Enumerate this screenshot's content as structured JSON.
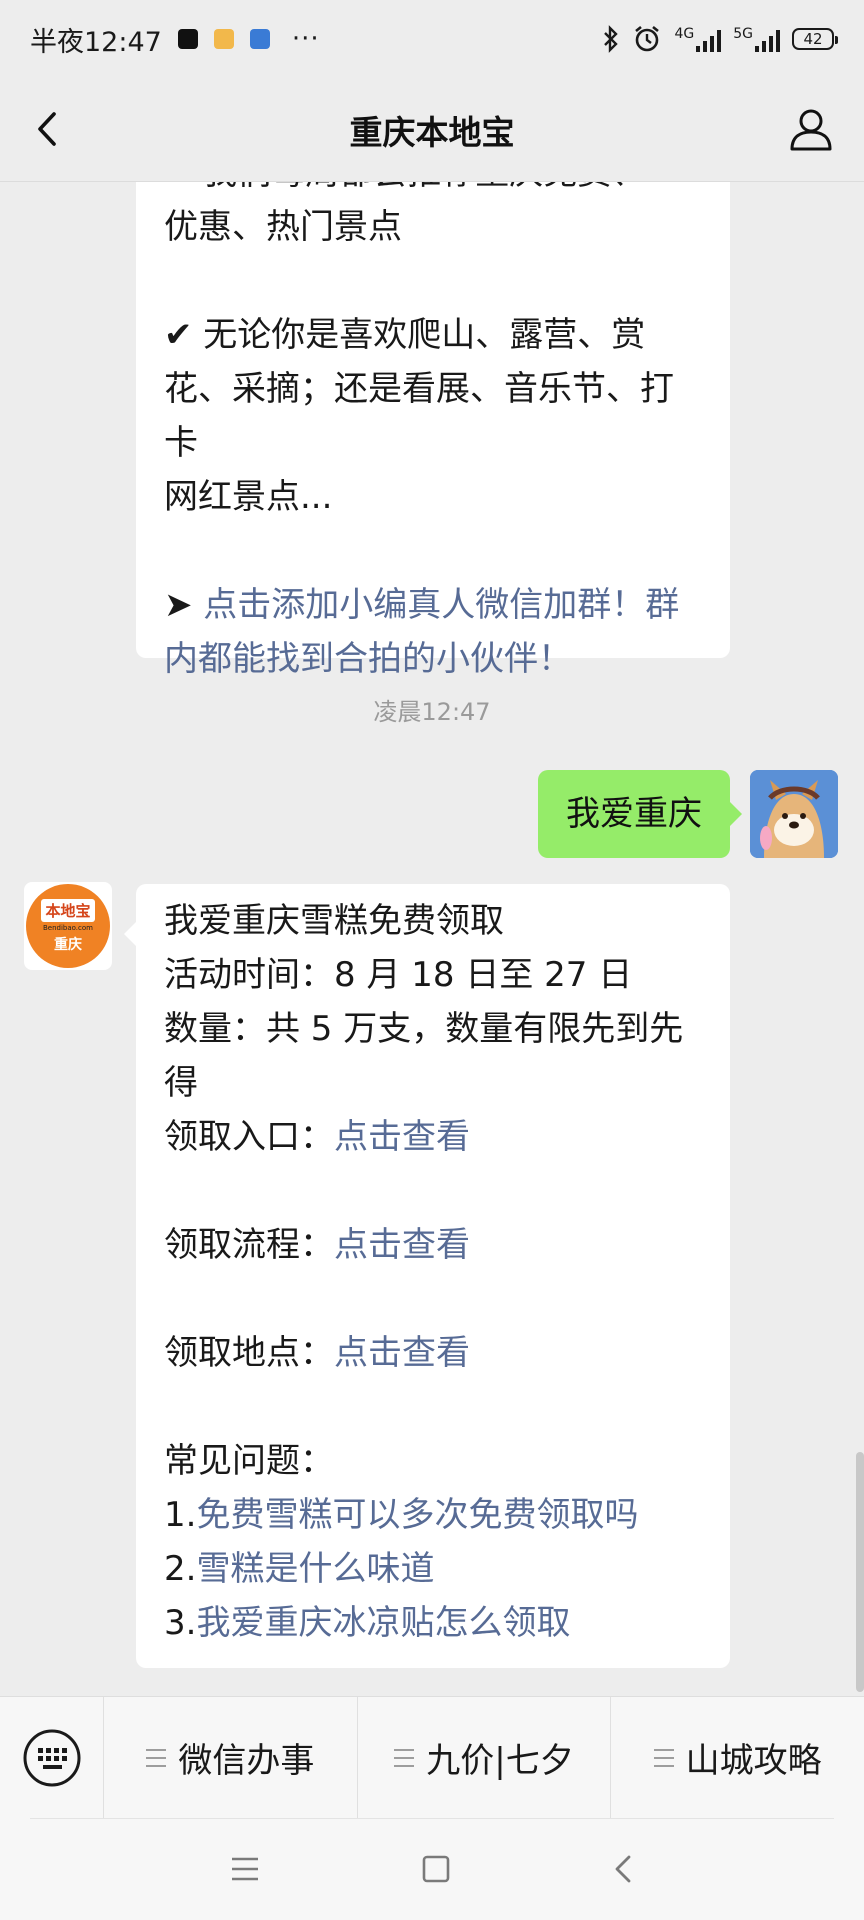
{
  "status_bar": {
    "time": "半夜12:47",
    "dots": "···",
    "net1": "4G",
    "net2": "5G",
    "battery": "42"
  },
  "header": {
    "title": "重庆本地宝"
  },
  "chat": {
    "top_bubble": {
      "line1": "✔ 我们每周都会推荐重庆免费、",
      "line2": "优惠、热门景点",
      "line3": "✔ 无论你是喜欢爬山、露营、赏",
      "line4": "花、采摘；还是看展、音乐节、打卡",
      "line5": "网红景点...",
      "line6_prefix": "➤ ",
      "line6_link": "点击添加小编真人微信加群！群",
      "line7_link": "内都能找到合拍的小伙伴！"
    },
    "timestamp": "凌晨12:47",
    "my_message": "我爱重庆",
    "bot_avatar": {
      "label_top": "本地宝",
      "site": "Bendibao.com",
      "label_bottom": "重庆"
    },
    "bot_reply": {
      "title": "我爱重庆雪糕免费领取",
      "time": "活动时间：8 月 18 日至 27 日",
      "qty1": "数量：共 5 万支，数量有限先到先",
      "qty2": "得",
      "entry_label": "领取入口：",
      "entry_link": "点击查看",
      "flow_label": "领取流程：",
      "flow_link": "点击查看",
      "place_label": "领取地点：",
      "place_link": "点击查看",
      "faq_title": "常见问题：",
      "faq": [
        {
          "num": "1.",
          "text": "免费雪糕可以多次免费领取吗"
        },
        {
          "num": "2.",
          "text": "雪糕是什么味道"
        },
        {
          "num": "3.",
          "text": "我爱重庆冰凉贴怎么领取"
        }
      ]
    }
  },
  "menu": {
    "items": [
      "微信办事",
      "九价|七夕",
      "山城攻略"
    ]
  },
  "colors": {
    "background": "#ededed",
    "link": "#576b95",
    "my_bubble": "#95ec69",
    "brand_orange": "#f08224"
  }
}
